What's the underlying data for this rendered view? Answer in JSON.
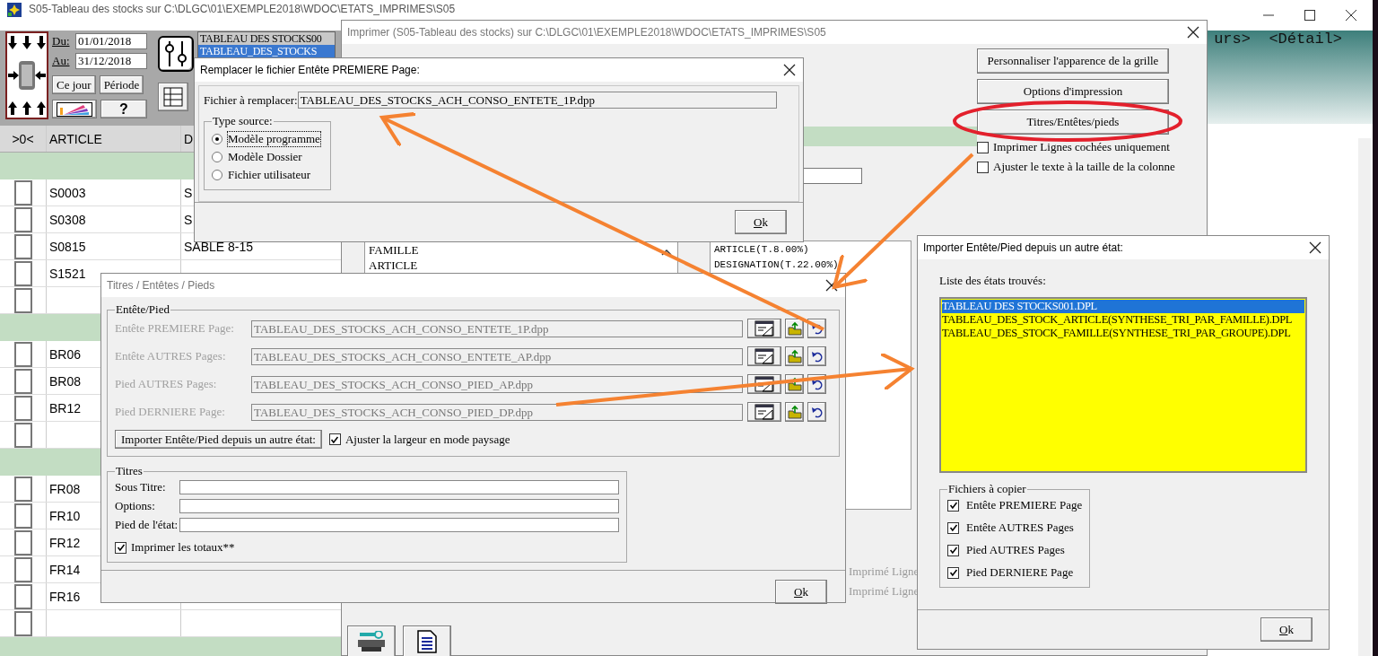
{
  "main_window": {
    "title": "S05-Tableau des stocks sur C:\\DLGC\\01\\EXEMPLE2018\\WDOC\\ETATS_IMPRIMES\\S05",
    "date_from_label": "Du:",
    "date_from": "01/01/2018",
    "date_to_label": "Au:",
    "date_to": "31/12/2018",
    "buttons": [
      "Ce jour",
      "Période",
      "?"
    ],
    "report_list": [
      {
        "label": "TABLEAU DES STOCKS00",
        "selected": false
      },
      {
        "label": "TABLEAU_DES_STOCKS",
        "selected": true
      }
    ],
    "header_text": "urs>  <Détail>",
    "grid": {
      "columns": [
        ">0<",
        "ARTICLE",
        "D"
      ],
      "rows": [
        {
          "kind": "group"
        },
        {
          "kind": "item",
          "article": "S0003",
          "designation": "S",
          "checked": false
        },
        {
          "kind": "item",
          "article": "S0308",
          "designation": "S",
          "checked": false
        },
        {
          "kind": "item",
          "article": "S0815",
          "designation": "SABLE 8-15",
          "checked": false
        },
        {
          "kind": "item",
          "article": "S1521",
          "checked": false
        },
        {
          "kind": "blank",
          "checked": false
        },
        {
          "kind": "group"
        },
        {
          "kind": "item",
          "article": "BR06",
          "checked": false
        },
        {
          "kind": "item",
          "article": "BR08",
          "checked": false
        },
        {
          "kind": "item",
          "article": "BR12",
          "checked": false
        },
        {
          "kind": "blank",
          "checked": false
        },
        {
          "kind": "group"
        },
        {
          "kind": "item",
          "article": "FR08",
          "checked": false
        },
        {
          "kind": "item",
          "article": "FR10",
          "checked": false
        },
        {
          "kind": "item",
          "article": "FR12",
          "checked": false
        },
        {
          "kind": "item",
          "article": "FR14",
          "checked": false
        },
        {
          "kind": "item",
          "article": "FR16",
          "checked": false
        },
        {
          "kind": "blank",
          "checked": false
        },
        {
          "kind": "group"
        }
      ]
    }
  },
  "print_window": {
    "title": "Imprimer (S05-Tableau des stocks)  sur C:\\DLGC\\01\\EXEMPLE2018\\WDOC\\ETATS_IMPRIMES\\S05",
    "buttons": [
      "Personnaliser l'apparence de la grille",
      "Options d'impression",
      "Titres/Entêtes/pieds"
    ],
    "options": [
      {
        "label": "Imprimer Lignes cochées uniquement",
        "checked": false
      },
      {
        "label": "Ajuster le texte à la taille de la colonne",
        "checked": false
      }
    ],
    "fields_list": [
      "FAMILLE",
      "ARTICLE"
    ],
    "columns_list": [
      "ARTICLE(T.8.00%)",
      "DESIGNATION(T.22.00%)"
    ],
    "print_flags": [
      "Imprimé Ligne",
      "Imprimé Ligne"
    ]
  },
  "replace_dialog": {
    "title": "Remplacer le fichier Entête PREMIERE Page:",
    "file_label": "Fichier à remplacer:",
    "file_value": "TABLEAU_DES_STOCKS_ACH_CONSO_ENTETE_1P.dpp",
    "source_group": "Type source:",
    "sources": [
      {
        "label": "Modèle programme",
        "selected": true
      },
      {
        "label": "Modèle Dossier",
        "selected": false
      },
      {
        "label": "Fichier utilisateur",
        "selected": false
      }
    ],
    "ok": "Ok"
  },
  "titles_dialog": {
    "title": "Titres / Entêtes / Pieds",
    "header_footer_group": "Entête/Pied",
    "files": [
      {
        "label": "Entête PREMIERE Page:",
        "value": "TABLEAU_DES_STOCKS_ACH_CONSO_ENTETE_1P.dpp"
      },
      {
        "label": "Entête AUTRES Pages:",
        "value": "TABLEAU_DES_STOCKS_ACH_CONSO_ENTETE_AP.dpp"
      },
      {
        "label": "Pied AUTRES Pages:",
        "value": "TABLEAU_DES_STOCKS_ACH_CONSO_PIED_AP.dpp"
      },
      {
        "label": "Pied DERNIERE Page:",
        "value": "TABLEAU_DES_STOCKS_ACH_CONSO_PIED_DP.dpp"
      }
    ],
    "import_button": "Importer Entête/Pied depuis un autre état:",
    "landscape": {
      "label": "Ajuster la largeur en mode paysage",
      "checked": true
    },
    "titles_group": "Titres",
    "title_fields": [
      {
        "label": "Sous Titre:"
      },
      {
        "label": "Options:"
      },
      {
        "label": "Pied de l'état:"
      }
    ],
    "print_totals": {
      "label": "Imprimer les totaux**",
      "checked": true
    },
    "ok": "Ok"
  },
  "import_dialog": {
    "title": "Importer Entête/Pied depuis un autre état:",
    "list_label": "Liste des états trouvés:",
    "states": [
      {
        "label": "TABLEAU DES STOCKS001.DPL",
        "selected": true
      },
      {
        "label": "TABLEAU_DES_STOCK_ARTICLE(SYNTHESE_TRI_PAR_FAMILLE).DPL",
        "selected": false
      },
      {
        "label": "TABLEAU_DES_STOCK_FAMILLE(SYNTHESE_TRI_PAR_GROUPE).DPL",
        "selected": false
      }
    ],
    "copy_group": "Fichiers à copier",
    "copy_files": [
      {
        "label": "Entête PREMIERE Page",
        "checked": true
      },
      {
        "label": "Entête AUTRES Pages",
        "checked": true
      },
      {
        "label": "Pied AUTRES Pages",
        "checked": true
      },
      {
        "label": "Pied DERNIERE Page",
        "checked": true
      }
    ],
    "ok": "Ok"
  }
}
